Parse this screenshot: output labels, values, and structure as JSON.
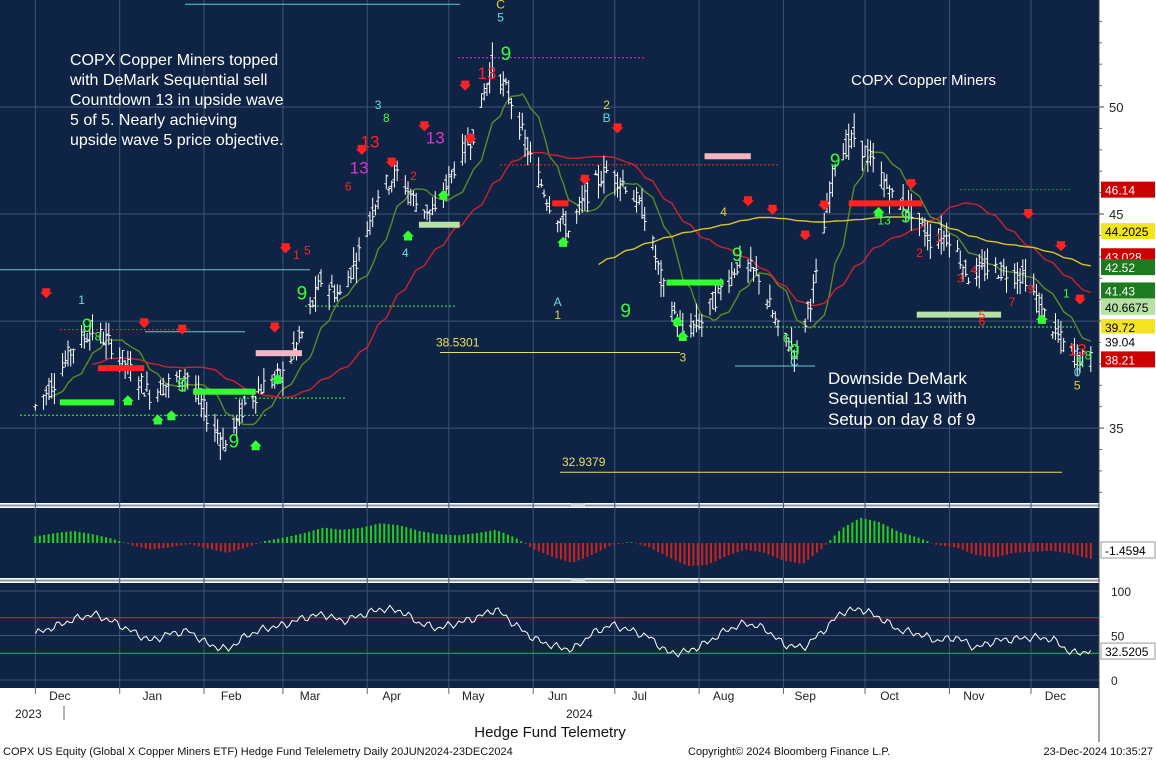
{
  "colors": {
    "panel_bg": "#0f2444",
    "grid": "#3d5478",
    "bar": "#ffffff",
    "ma_fast": "#5f8a2a",
    "ma_mid": "#cc2233",
    "ma_slow": "#d6c32a",
    "macd_up": "#22cc22",
    "macd_down": "#cc2222",
    "rsi_line": "#ffffff",
    "rsi_ob": "#cc2233",
    "rsi_os": "#22aa33",
    "setup_green": "#33ff33",
    "sell_red": "#ff2222",
    "annot_text": "#ffffff",
    "fib": "#e8e060"
  },
  "chart_data": {
    "type": "candlestick",
    "title": "COPX Copper Miners",
    "symbol": "COPX",
    "x_ticks": [
      "Dec",
      "Jan",
      "Feb",
      "Mar",
      "Apr",
      "May",
      "Jun",
      "Jul",
      "Aug",
      "Sep",
      "Oct",
      "Nov",
      "Dec"
    ],
    "year_labels": [
      "2023",
      "2024"
    ],
    "price_axis": {
      "range": [
        31.5,
        55.0
      ],
      "ticks": [
        35,
        40,
        45,
        50
      ],
      "tick_labels": [
        "35",
        "",
        "45",
        "50"
      ]
    },
    "price_points": [
      [
        "2023-12-01",
        36.0
      ],
      [
        "2023-12-08",
        37.2
      ],
      [
        "2023-12-15",
        38.8
      ],
      [
        "2023-12-22",
        39.6
      ],
      [
        "2023-12-29",
        38.9
      ],
      [
        "2024-01-05",
        37.7
      ],
      [
        "2024-01-12",
        36.6
      ],
      [
        "2024-01-19",
        37.1
      ],
      [
        "2024-01-26",
        37.5
      ],
      [
        "2024-02-02",
        35.6
      ],
      [
        "2024-02-09",
        34.2
      ],
      [
        "2024-02-16",
        36.1
      ],
      [
        "2024-02-23",
        37.0
      ],
      [
        "2024-03-01",
        37.5
      ],
      [
        "2024-03-08",
        39.4
      ],
      [
        "2024-03-15",
        41.9
      ],
      [
        "2024-03-22",
        41.2
      ],
      [
        "2024-03-29",
        43.2
      ],
      [
        "2024-04-05",
        46.0
      ],
      [
        "2024-04-12",
        46.9
      ],
      [
        "2024-04-19",
        45.5
      ],
      [
        "2024-04-26",
        45.0
      ],
      [
        "2024-05-03",
        47.2
      ],
      [
        "2024-05-10",
        48.8
      ],
      [
        "2024-05-17",
        52.0
      ],
      [
        "2024-05-24",
        50.3
      ],
      [
        "2024-05-31",
        47.6
      ],
      [
        "2024-06-07",
        45.5
      ],
      [
        "2024-06-14",
        44.2
      ],
      [
        "2024-06-21",
        46.0
      ],
      [
        "2024-06-28",
        47.0
      ],
      [
        "2024-07-05",
        46.4
      ],
      [
        "2024-07-12",
        45.0
      ],
      [
        "2024-07-19",
        41.5
      ],
      [
        "2024-07-26",
        39.5
      ],
      [
        "2024-08-02",
        40.0
      ],
      [
        "2024-08-09",
        41.5
      ],
      [
        "2024-08-16",
        42.8
      ],
      [
        "2024-08-23",
        42.1
      ],
      [
        "2024-08-30",
        39.6
      ],
      [
        "2024-09-06",
        38.5
      ],
      [
        "2024-09-13",
        42.0
      ],
      [
        "2024-09-20",
        47.5
      ],
      [
        "2024-09-27",
        48.6
      ],
      [
        "2024-10-04",
        47.4
      ],
      [
        "2024-10-11",
        45.8
      ],
      [
        "2024-10-18",
        45.2
      ],
      [
        "2024-10-25",
        43.8
      ],
      [
        "2024-11-01",
        44.0
      ],
      [
        "2024-11-08",
        42.1
      ],
      [
        "2024-11-15",
        42.5
      ],
      [
        "2024-11-22",
        42.3
      ],
      [
        "2024-11-29",
        42.1
      ],
      [
        "2024-12-06",
        40.3
      ],
      [
        "2024-12-13",
        38.9
      ],
      [
        "2024-12-20",
        38.2
      ]
    ],
    "last_price": 39.04,
    "price_tags": [
      {
        "value": 46.14,
        "label": "46.14",
        "bg": "#cc0000",
        "fg": "#ffffff"
      },
      {
        "value": 44.2025,
        "label": "44.2025",
        "bg": "#f2e41e",
        "fg": "#000000"
      },
      {
        "value": 43.028,
        "label": "43.028",
        "bg": "#cc0000",
        "fg": "#ffffff"
      },
      {
        "value": 42.52,
        "label": "42.52",
        "bg": "#1e7a1e",
        "fg": "#ffffff"
      },
      {
        "value": 41.43,
        "label": "41.43",
        "bg": "#1e7a1e",
        "fg": "#ffffff"
      },
      {
        "value": 40.6675,
        "label": "40.6675",
        "bg": "#b6e0a4",
        "fg": "#000000"
      },
      {
        "value": 39.72,
        "label": "39.72",
        "bg": "#f2e41e",
        "fg": "#000000"
      },
      {
        "value": 39.04,
        "label": "39.04",
        "bg": "#ffffff",
        "fg": "#000000"
      },
      {
        "value": 38.21,
        "label": "38.21",
        "bg": "#cc0000",
        "fg": "#ffffff"
      }
    ],
    "fib_levels": [
      {
        "value": 38.5301,
        "label": "38.5301"
      },
      {
        "value": 32.9379,
        "label": "32.9379"
      }
    ],
    "annotations": [
      {
        "text": "COPX Copper Miners topped"
      },
      {
        "text": "with DeMark Sequential sell"
      },
      {
        "text": "Countdown 13 in upside wave"
      },
      {
        "text": "5 of 5.  Nearly achieving"
      },
      {
        "text": "upside wave 5 price objective."
      },
      {
        "text": "Downside DeMark"
      },
      {
        "text": "Sequential 13 with"
      },
      {
        "text": "Setup on day 8 of 9"
      }
    ],
    "demark_labels": [
      {
        "date": "2024-05-15",
        "price": 51.3,
        "text": "13",
        "color": "#ff2222"
      },
      {
        "date": "2024-04-02",
        "price": 48.1,
        "text": "13",
        "color": "#ff2222"
      },
      {
        "date": "2024-03-29",
        "price": 46.9,
        "text": "13",
        "color": "#dd33cc"
      },
      {
        "date": "2024-04-26",
        "price": 48.3,
        "text": "13",
        "color": "#dd33cc"
      },
      {
        "date": "2024-12-18",
        "price": 38.4,
        "text": "13",
        "color": "#ff2222"
      },
      {
        "date": "2024-05-22",
        "price": 52.2,
        "text": "9",
        "color": "#33ff33"
      },
      {
        "date": "2024-03-08",
        "price": 41.0,
        "text": "9",
        "color": "#33ff33"
      },
      {
        "date": "2024-02-12",
        "price": 34.1,
        "text": "9",
        "color": "#33ff33"
      },
      {
        "date": "2024-08-15",
        "price": 42.8,
        "text": "9",
        "color": "#33ff33"
      },
      {
        "date": "2024-09-05",
        "price": 38.3,
        "text": "9",
        "color": "#33ff33"
      },
      {
        "date": "2024-09-20",
        "price": 47.2,
        "text": "9",
        "color": "#33ff33"
      },
      {
        "date": "2024-07-05",
        "price": 40.2,
        "text": "9",
        "color": "#33ff33"
      },
      {
        "date": "2023-12-20",
        "price": 39.5,
        "text": "9",
        "color": "#33ff33"
      },
      {
        "date": "2024-01-24",
        "price": 36.7,
        "text": "9",
        "color": "#33ff33"
      },
      {
        "date": "2024-10-16",
        "price": 44.6,
        "text": "9",
        "color": "#33ff33"
      }
    ],
    "setup_bars": [
      {
        "from": "2024-04-20",
        "to": "2024-05-05",
        "price": 44.5,
        "color": "#b6e0a4"
      },
      {
        "from": "2024-08-03",
        "to": "2024-08-20",
        "price": 47.7,
        "color": "#f5b5c0"
      },
      {
        "from": "2024-10-20",
        "to": "2024-11-20",
        "price": 40.3,
        "color": "#b6e0a4"
      },
      {
        "from": "2024-09-25",
        "to": "2024-10-22",
        "price": 45.5,
        "color": "#ff2222"
      },
      {
        "from": "2024-07-20",
        "to": "2024-08-10",
        "price": 41.8,
        "color": "#33ff33"
      },
      {
        "from": "2024-06-08",
        "to": "2024-06-14",
        "price": 45.5,
        "color": "#ff2222"
      },
      {
        "from": "2023-12-24",
        "to": "2024-01-10",
        "price": 37.8,
        "color": "#ff2222"
      },
      {
        "from": "2024-01-28",
        "to": "2024-02-20",
        "price": 36.7,
        "color": "#33ff33"
      },
      {
        "from": "2024-02-20",
        "to": "2024-03-08",
        "price": 38.5,
        "color": "#f5b5c0"
      },
      {
        "from": "2023-12-10",
        "to": "2023-12-30",
        "price": 36.2,
        "color": "#33ff33"
      }
    ],
    "macd": {
      "label": "-1.4594",
      "value": -1.4594,
      "values": [
        0.6,
        0.9,
        1.1,
        0.8,
        0.4,
        -0.2,
        -0.6,
        -0.4,
        -0.1,
        -0.5,
        -0.9,
        -0.4,
        0.2,
        0.5,
        0.9,
        1.4,
        1.2,
        1.4,
        1.8,
        1.6,
        1.1,
        0.8,
        0.7,
        0.9,
        1.2,
        0.5,
        -0.6,
        -1.3,
        -1.8,
        -1.1,
        -0.2,
        0.1,
        -0.4,
        -1.3,
        -2.1,
        -2.0,
        -1.2,
        -0.6,
        -0.9,
        -1.6,
        -1.9,
        -0.5,
        1.3,
        2.3,
        1.9,
        1.0,
        0.5,
        -0.2,
        -0.4,
        -1.1,
        -1.3,
        -0.9,
        -0.8,
        -0.7,
        -1.0,
        -1.45
      ]
    },
    "rsi": {
      "label": "32.5205",
      "value": 32.5205,
      "ticks": [
        0,
        50,
        100
      ],
      "overbought": 70,
      "oversold": 30,
      "values": [
        52,
        60,
        68,
        74,
        66,
        55,
        44,
        52,
        55,
        40,
        34,
        50,
        58,
        62,
        70,
        74,
        66,
        73,
        80,
        78,
        64,
        58,
        64,
        70,
        80,
        62,
        46,
        38,
        34,
        52,
        62,
        56,
        48,
        30,
        32,
        42,
        56,
        64,
        58,
        40,
        36,
        54,
        76,
        80,
        70,
        56,
        52,
        44,
        48,
        36,
        44,
        46,
        48,
        46,
        30,
        32.5
      ]
    },
    "bottom_center": "Hedge Fund Telemetry",
    "footer_left": "COPX US Equity (Global X Copper Miners ETF) Hedge Fund Telelemetry  Daily 20JUN2024-23DEC2024",
    "footer_mid": "Copyright© 2024 Bloomberg Finance L.P.",
    "footer_right": "23-Dec-2024 10:35:27"
  }
}
